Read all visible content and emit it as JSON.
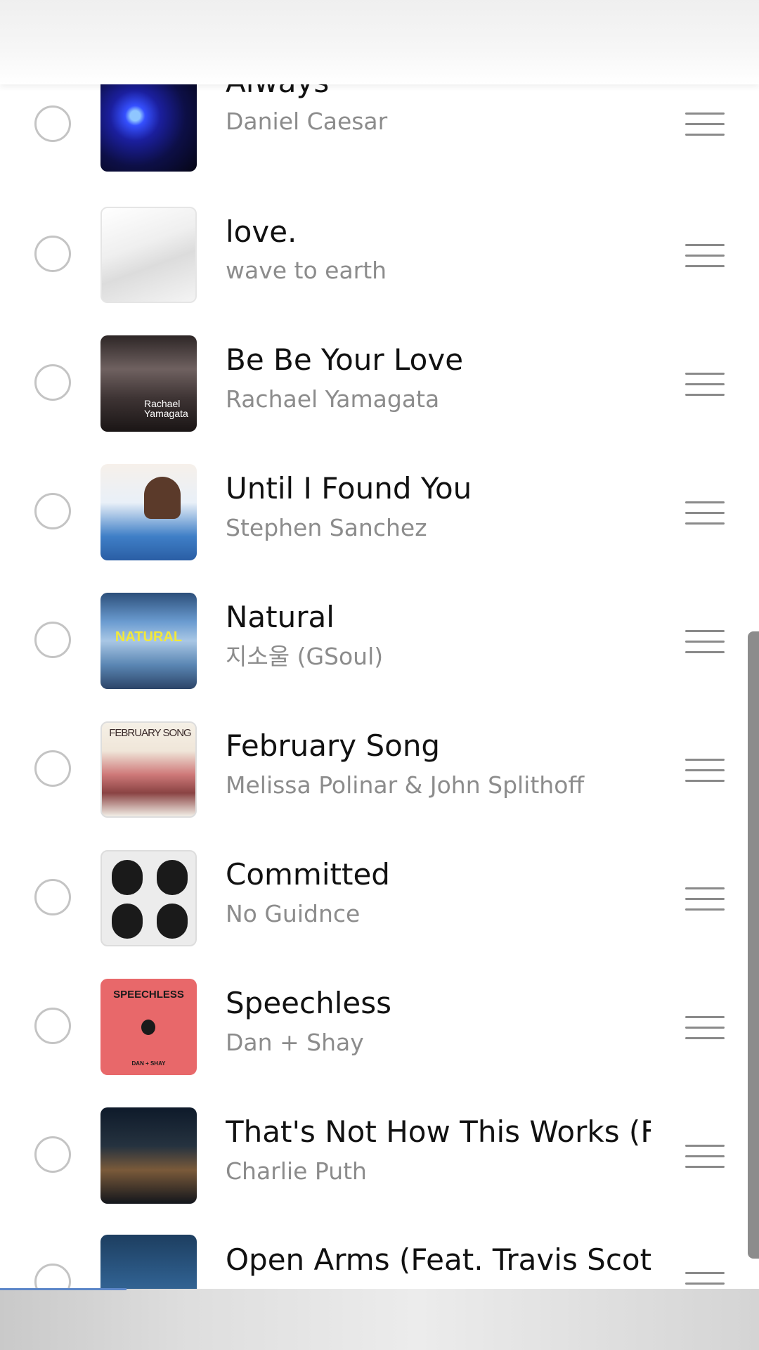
{
  "tracks": [
    {
      "title": "Always",
      "artist": "Daniel Caesar",
      "art": "album-art-always"
    },
    {
      "title": "love.",
      "artist": "wave to earth",
      "art": "album-art-love"
    },
    {
      "title": "Be Be Your Love",
      "artist": "Rachael Yamagata",
      "art": "album-art-be-be-your-love",
      "art_text": "Rachael\nYamagata"
    },
    {
      "title": "Until I Found You",
      "artist": "Stephen Sanchez",
      "art": "album-art-until-i-found-you"
    },
    {
      "title": "Natural",
      "artist": "지소울 (GSoul)",
      "art": "album-art-natural",
      "art_text": "NATURAL"
    },
    {
      "title": "February Song",
      "artist": "Melissa Polinar & John Splithoff",
      "art": "album-art-february-song",
      "art_text": "FEBRUARY SONG"
    },
    {
      "title": "Committed",
      "artist": "No Guidnce",
      "art": "album-art-committed"
    },
    {
      "title": "Speechless",
      "artist": "Dan + Shay",
      "art": "album-art-speechless",
      "art_text": "SPEECHLESS",
      "art_subtext": "DAN + SHAY"
    },
    {
      "title": "That's Not How This Works (Fe..",
      "artist": "Charlie Puth",
      "art": "album-art-thats-not-how-this-works"
    },
    {
      "title": "Open Arms (Feat. Travis Scott)",
      "artist": "",
      "art": "album-art-open-arms"
    }
  ],
  "colors": {
    "checkbox_border": "#c4c4c4",
    "title_text": "#111111",
    "artist_text": "#8c8c8c",
    "handle": "#8a8a8a",
    "scrollbar": "#8c8c8c"
  }
}
